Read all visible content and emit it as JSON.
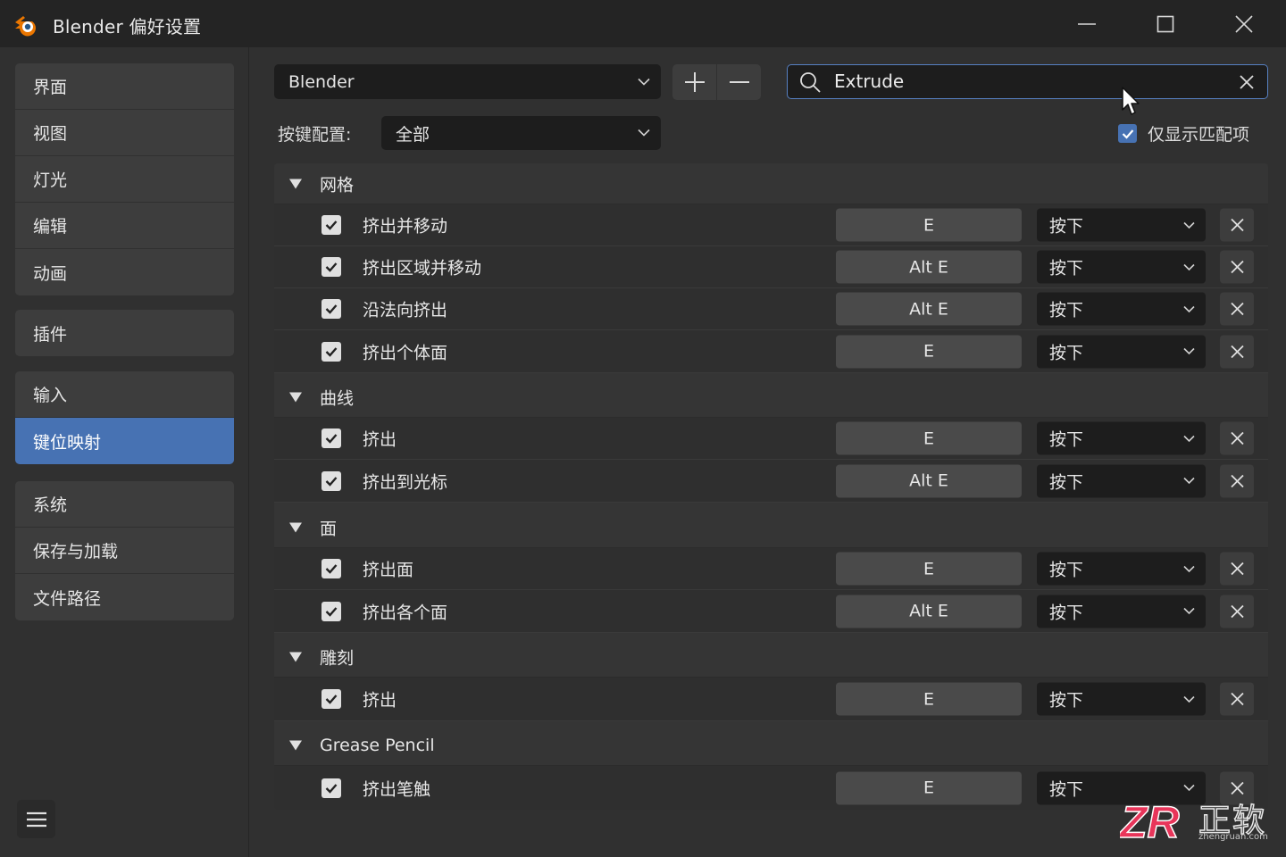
{
  "window": {
    "title": "Blender 偏好设置",
    "icons": {
      "logo": "blender-logo-icon",
      "minimize": "minimize-icon",
      "maximize": "maximize-icon",
      "close": "close-icon"
    }
  },
  "sidebar": {
    "groups": [
      {
        "items": [
          "界面",
          "视图",
          "灯光",
          "编辑",
          "动画"
        ]
      },
      {
        "items": [
          "插件"
        ]
      },
      {
        "items": [
          "输入",
          "键位映射"
        ]
      },
      {
        "items": [
          "系统",
          "保存与加载",
          "文件路径"
        ]
      }
    ],
    "active_item": "键位映射",
    "menu_icon": "hamburger-menu-icon"
  },
  "toolbar": {
    "preset_value": "Blender",
    "add_icon": "plus-icon",
    "remove_icon": "minus-icon",
    "search_value": "Extrude",
    "search_icon": "search-icon",
    "clear_icon": "clear-search-icon",
    "keymap_label": "按键配置:",
    "keymap_value": "全部",
    "only_matching_label": "仅显示匹配项",
    "only_matching_checked": true
  },
  "list": {
    "categories": [
      {
        "name": "网格",
        "items": [
          {
            "label": "挤出并移动",
            "key": "E",
            "event": "按下"
          },
          {
            "label": "挤出区域并移动",
            "key": "Alt E",
            "event": "按下"
          },
          {
            "label": "沿法向挤出",
            "key": "Alt E",
            "event": "按下"
          },
          {
            "label": "挤出个体面",
            "key": "E",
            "event": "按下"
          }
        ]
      },
      {
        "name": "曲线",
        "items": [
          {
            "label": "挤出",
            "key": "E",
            "event": "按下"
          },
          {
            "label": "挤出到光标",
            "key": "Alt E",
            "event": "按下"
          }
        ]
      },
      {
        "name": "面",
        "items": [
          {
            "label": "挤出面",
            "key": "E",
            "event": "按下"
          },
          {
            "label": "挤出各个面",
            "key": "Alt E",
            "event": "按下"
          }
        ]
      },
      {
        "name": "雕刻",
        "items": [
          {
            "label": "挤出",
            "key": "E",
            "event": "按下"
          }
        ]
      },
      {
        "name": "Grease Pencil",
        "items": [
          {
            "label": "挤出笔触",
            "key": "E",
            "event": "按下"
          }
        ]
      }
    ]
  },
  "watermark": {
    "logo_text": "ZR",
    "name": "正软",
    "url": "zhengruan.com"
  },
  "colors": {
    "accent": "#4772b3",
    "search_border": "#5680c2",
    "background": "#303030",
    "titlebar": "#242424"
  }
}
